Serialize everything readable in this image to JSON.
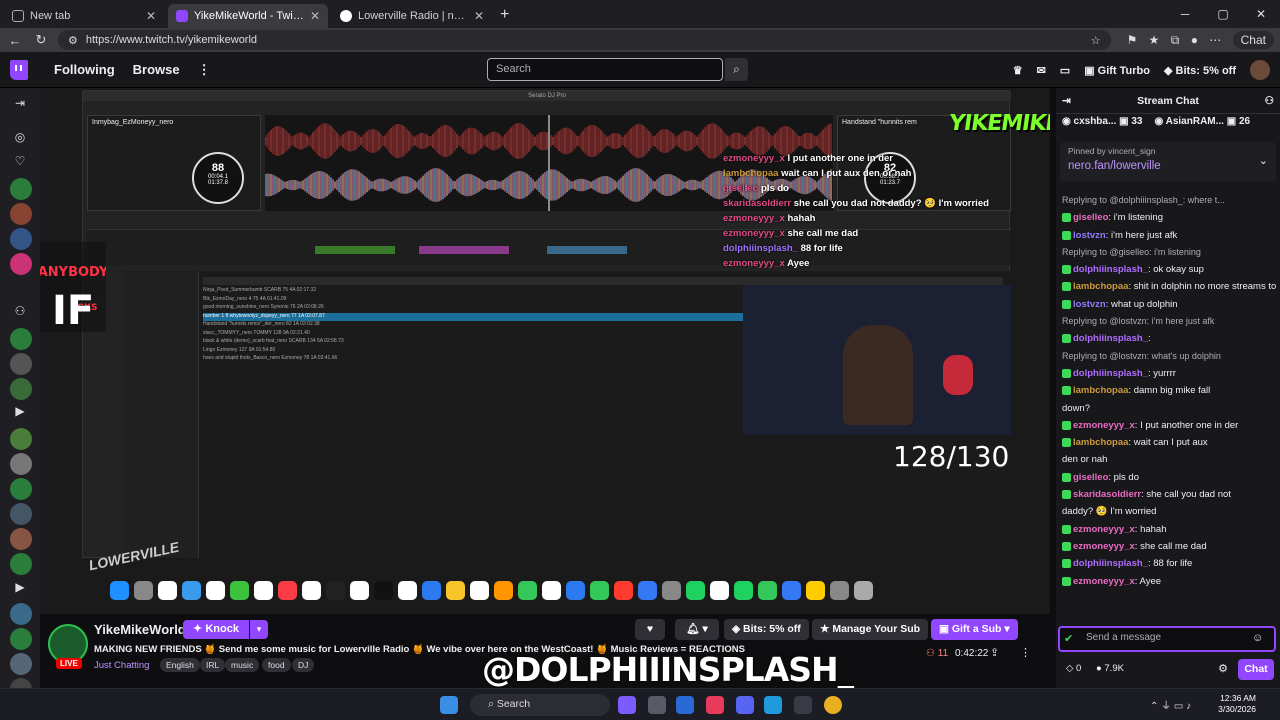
{
  "browser": {
    "tabs": [
      {
        "title": "New tab",
        "active": false
      },
      {
        "title": "YikeMikeWorld - Twitch",
        "active": true
      },
      {
        "title": "Lowerville Radio | nero",
        "active": false
      }
    ],
    "url": "https://www.twitch.tv/yikemikeworld",
    "chat_label": "Chat"
  },
  "topnav": {
    "following": "Following",
    "browse": "Browse",
    "search_placeholder": "Search",
    "gift_turbo": "Gift Turbo",
    "bits_offer": "Bits: 5% off"
  },
  "video": {
    "serato": {
      "app_title": "Serato DJ Pro",
      "deck1_track": "Inmybag_EzMoneyy_nero",
      "deck1_bpm": "88",
      "deck1_elapsed": "00:04.1",
      "deck1_remain": "01:37.8",
      "deck2_track": "Handstand \"hunnits rem",
      "deck2_bpm": "82",
      "deck2_elapsed": "00:38.7",
      "deck2_remain": "01:23.7",
      "brand": "YIKEMIKE"
    },
    "overlay_chat": [
      {
        "user": "ezmoneyyy_x",
        "text": "I put another one in der",
        "cls": "u1"
      },
      {
        "user": "lambchopaa",
        "text": "wait can I put aux den or nah",
        "cls": "u2"
      },
      {
        "user": "giselleo",
        "text": "pls do",
        "cls": "u1"
      },
      {
        "user": "skaridasoldierr",
        "text": "she call you dad not daddy? 🥺 I'm worried",
        "cls": "u1"
      },
      {
        "user": "ezmoneyyy_x",
        "text": "hahah",
        "cls": "u1"
      },
      {
        "user": "ezmoneyyy_x",
        "text": "she call me dad",
        "cls": "u1"
      },
      {
        "user": "dolphiiinsplash_",
        "text": "88 for life",
        "cls": "u3"
      },
      {
        "user": "ezmoneyyy_x",
        "text": "Ayee",
        "cls": "u1"
      }
    ],
    "library_rows": [
      "Ninja_Pivot_Summerbumb   SCARB   75   4A   02:17.32",
      "Bik_EzmoDay_nero         4       75   4A   01:41.09",
      "good morning_sunshine_nero  Synonie  76  2A  02:08.26",
      "number 1 ft whytewoolyz_dopeyy_nero   77   1A   02:07.87",
      "Handstand \"hunnits remix\"_der_nero      82   1A   02:02.38",
      "stacc_TOMMYY_nero    TOMMY   128   9A   02:21.40",
      "black & white (demo)_scarb feat_nero  SCARB  134  5A  02:58.73",
      "Lingo               Ezmoney   137   9A   01:54.80",
      "hoes and stupid thots_Basco_nero   Ezmoney   78   1A   02:41.66"
    ],
    "counter": "128/130",
    "anybody_logo": "IF ANYBODY ASKS",
    "mac_watermark": "LOWERVILLE"
  },
  "channel": {
    "name": "YikeMikeWorld",
    "live": "LIVE",
    "knock_label": "Knock",
    "title": "MAKING NEW FRIENDS 🍯 Send me some music for Lowerville Radio 🍯 We vibe over here on the WestCoast! 🍯 Music Reviews = REACTIONS",
    "category": "Just Chatting",
    "tags": [
      "English",
      "IRL",
      "music",
      "food",
      "DJ"
    ],
    "bits": "Bits: 5% off",
    "manage_sub": "Manage Your Sub",
    "gift_sub": "Gift a Sub",
    "viewers": "11",
    "uptime": "0:42:22",
    "overlay_handle": "@DOLPHIIINSPLASH_"
  },
  "chat": {
    "header": "Stream Chat",
    "leaderboard": [
      {
        "name": "cxshba...",
        "count": "33"
      },
      {
        "name": "AsianRAM...",
        "count": "26"
      }
    ],
    "pinned_by": "Pinned by  vincent_sign",
    "pinned_link": "nero.fan/lowerville",
    "messages": [
      {
        "reply": "Replying to @dolphiiinsplash_: where t...",
        "user": "",
        "text": "",
        "color": ""
      },
      {
        "reply": "",
        "user": "giselleo",
        "text": ": i'm listening",
        "color": "#e86cc4"
      },
      {
        "reply": "",
        "user": "lostvzn",
        "text": ": i'm here just afk",
        "color": "#8f7cff"
      },
      {
        "reply": "Replying to @giselleo: i'm listening",
        "user": "",
        "text": "",
        "color": ""
      },
      {
        "reply": "",
        "user": "dolphiiinsplash_",
        "text": ": ok okay sup",
        "color": "#b06cff"
      },
      {
        "reply": "",
        "user": "lambchopaa",
        "text": ": shit in dolphin no more streams tomorrow",
        "color": "#cc9a3c"
      },
      {
        "reply": "",
        "user": "lostvzn",
        "text": ": what up dolphin",
        "color": "#8f7cff"
      },
      {
        "reply": "Replying to @lostvzn: i'm here just afk",
        "user": "",
        "text": "",
        "color": ""
      },
      {
        "reply": "",
        "user": "dolphiiinsplash_",
        "text": ":",
        "color": "#b06cff"
      },
      {
        "reply": "Replying to @lostvzn: what's up dolphin",
        "user": "",
        "text": "",
        "color": ""
      },
      {
        "reply": "",
        "user": "dolphiiinsplash_",
        "text": ": yurrrr",
        "color": "#b06cff"
      },
      {
        "reply": "",
        "user": "lambchopaa",
        "text": ": damn big mike fall",
        "color": "#cc9a3c"
      },
      {
        "reply": "",
        "user": "",
        "text": "down?",
        "color": ""
      },
      {
        "reply": "",
        "user": "ezmoneyyy_x",
        "text": ": I put another one in der",
        "color": "#e86cc4"
      },
      {
        "reply": "",
        "user": "lambchopaa",
        "text": ": wait can I put aux",
        "color": "#cc9a3c"
      },
      {
        "reply": "",
        "user": "",
        "text": "den or nah",
        "color": ""
      },
      {
        "reply": "",
        "user": "giselleo",
        "text": ": pls do",
        "color": "#e86cc4"
      },
      {
        "reply": "",
        "user": "skaridasoldierr",
        "text": ": she call you dad not",
        "color": "#e86cc4"
      },
      {
        "reply": "",
        "user": "",
        "text": "daddy? 🥺 I'm worried",
        "color": ""
      },
      {
        "reply": "",
        "user": "ezmoneyyy_x",
        "text": ": hahah",
        "color": "#e86cc4"
      },
      {
        "reply": "",
        "user": "ezmoneyyy_x",
        "text": ": she call me dad",
        "color": "#e86cc4"
      },
      {
        "reply": "",
        "user": "dolphiiinsplash_",
        "text": ": 88 for life",
        "color": "#b06cff"
      },
      {
        "reply": "",
        "user": "ezmoneyyy_x",
        "text": ": Ayee",
        "color": "#e86cc4"
      }
    ],
    "input_placeholder": "Send a message",
    "points": "0",
    "bits_count": "7.9K",
    "chat_button": "Chat"
  },
  "taskbar": {
    "search": "Search",
    "time": "12:36 AM",
    "date": "3/30/2026"
  },
  "colors": {
    "accent": "#9146ff",
    "live": "#eb0400",
    "background": "#0e0e10"
  }
}
